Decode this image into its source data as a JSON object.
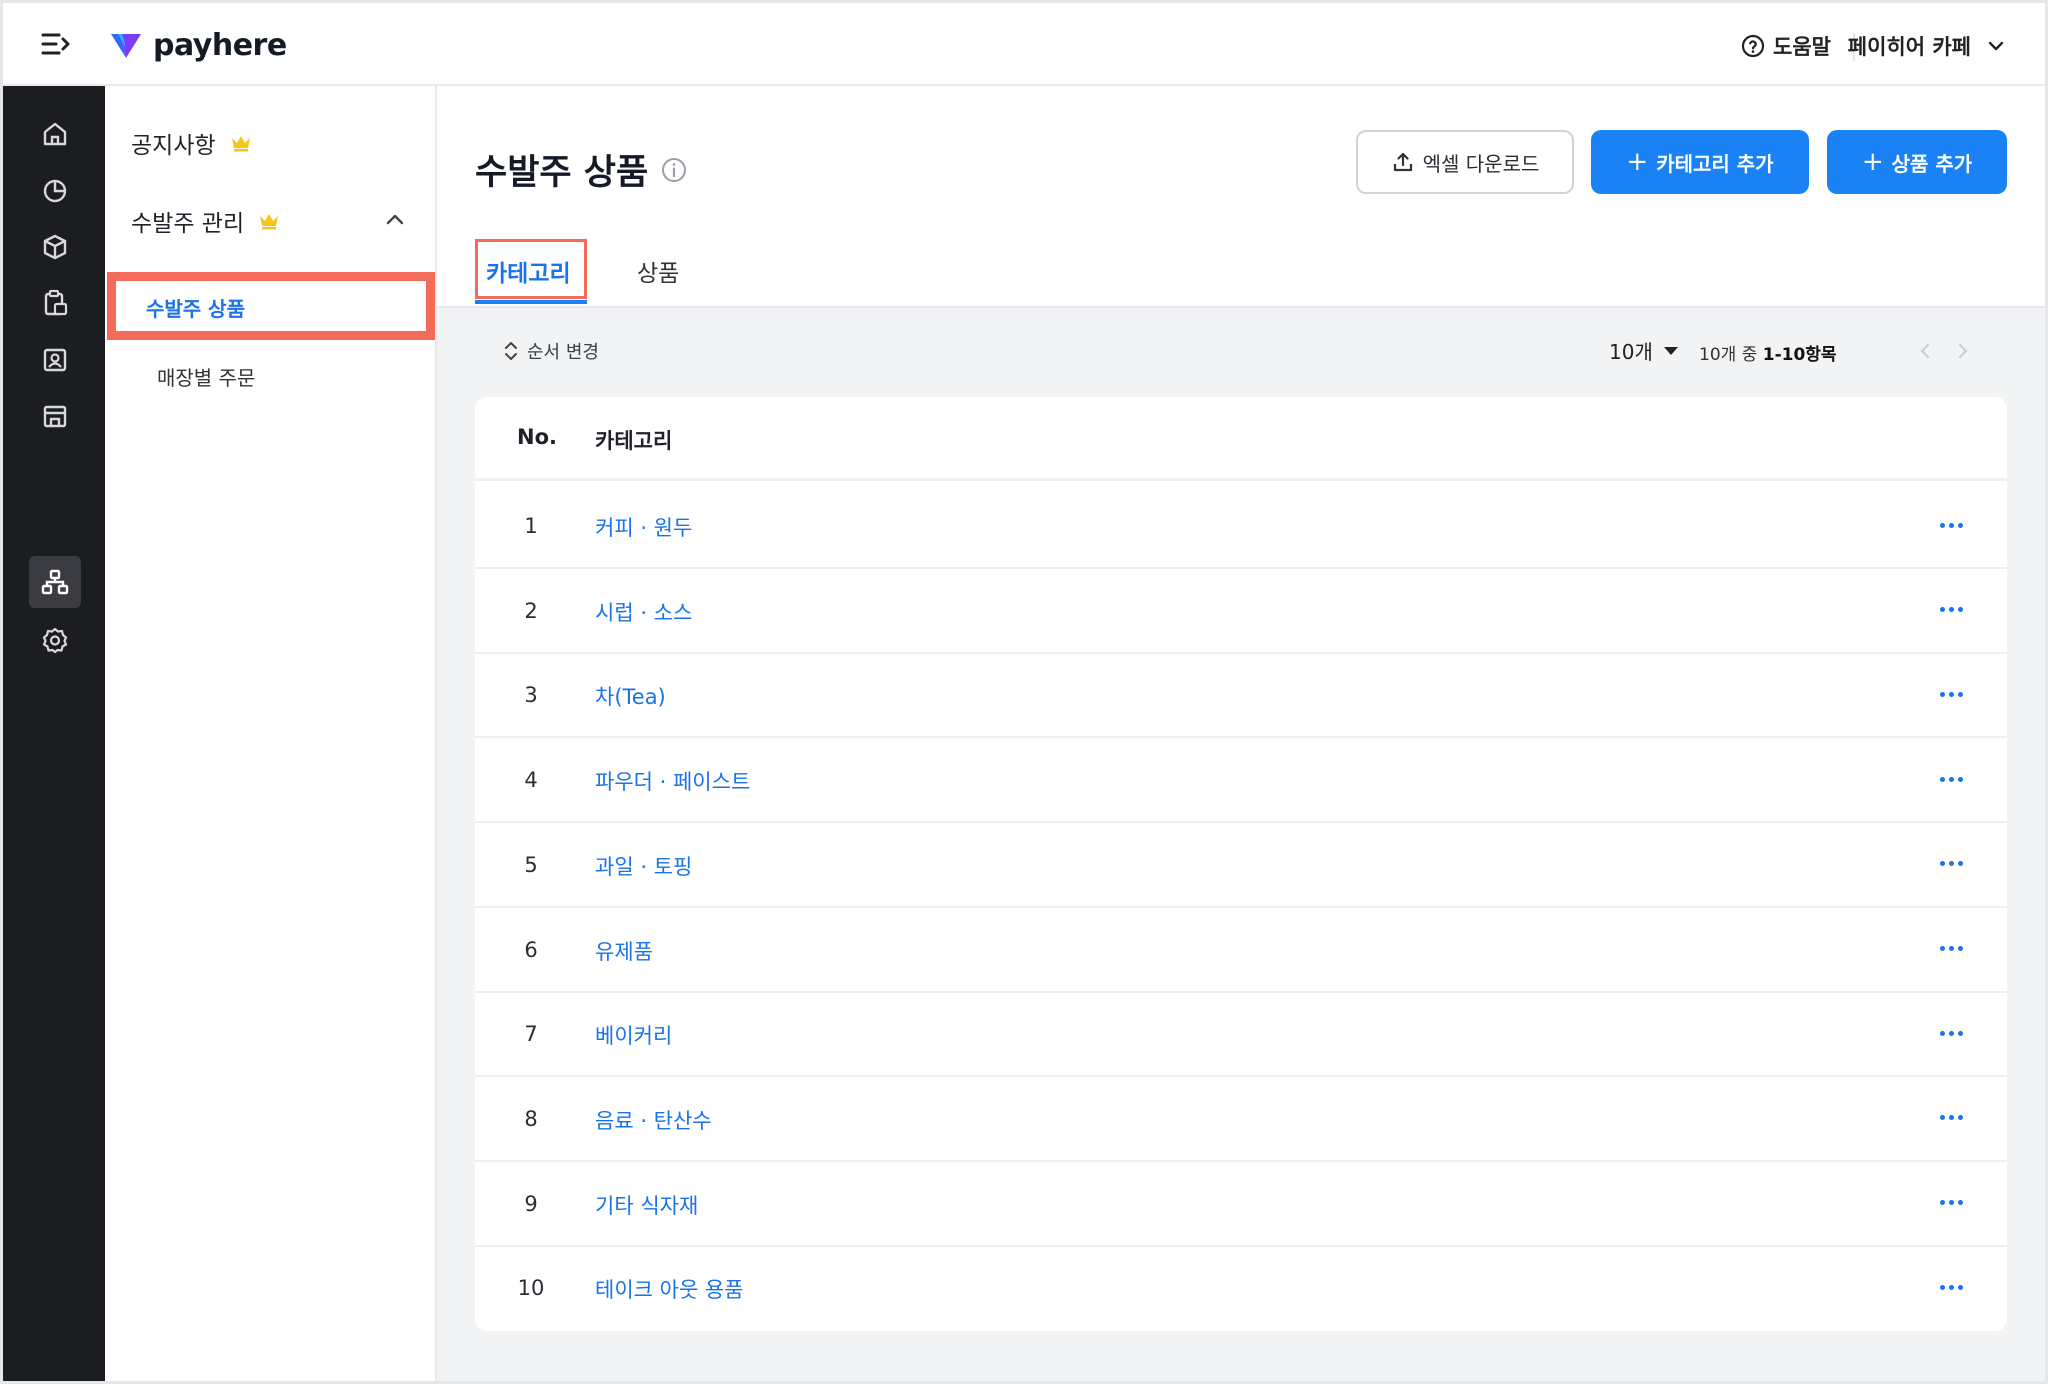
{
  "brand": {
    "name": "payhere",
    "accent": "#1a82f5",
    "highlight": "#f26b5b"
  },
  "header": {
    "help_label": "도움말",
    "store_name": "페이히어 카페"
  },
  "rail": {
    "icons": [
      "home-icon",
      "pie-chart-icon",
      "box-icon",
      "clipboard-icon",
      "contact-icon",
      "store-icon",
      "hierarchy-icon",
      "settings-icon"
    ],
    "active": "hierarchy-icon"
  },
  "submenu": {
    "notice": "공지사항",
    "order_mgmt": "수발주 관리",
    "order_products": "수발주 상품",
    "store_orders": "매장별 주문"
  },
  "page": {
    "title": "수발주 상품",
    "excel_button": "엑셀 다운로드",
    "add_category_button": "카테고리 추가",
    "add_product_button": "상품 추가",
    "tabs": [
      {
        "label": "카테고리",
        "active": true
      },
      {
        "label": "상품",
        "active": false
      }
    ]
  },
  "toolbar": {
    "reorder_label": "순서 변경",
    "per_page": "10개",
    "range_prefix": "10개 중",
    "range_value": "1-10항목"
  },
  "table": {
    "headers": {
      "no": "No.",
      "category": "카테고리"
    },
    "rows": [
      {
        "no": "1",
        "name": "커피 · 원두"
      },
      {
        "no": "2",
        "name": "시럽 · 소스"
      },
      {
        "no": "3",
        "name": "차(Tea)"
      },
      {
        "no": "4",
        "name": "파우더 · 페이스트"
      },
      {
        "no": "5",
        "name": "과일 · 토핑"
      },
      {
        "no": "6",
        "name": "유제품"
      },
      {
        "no": "7",
        "name": "베이커리"
      },
      {
        "no": "8",
        "name": "음료 · 탄산수"
      },
      {
        "no": "9",
        "name": "기타 식자재"
      },
      {
        "no": "10",
        "name": "테이크 아웃 용품"
      }
    ]
  }
}
